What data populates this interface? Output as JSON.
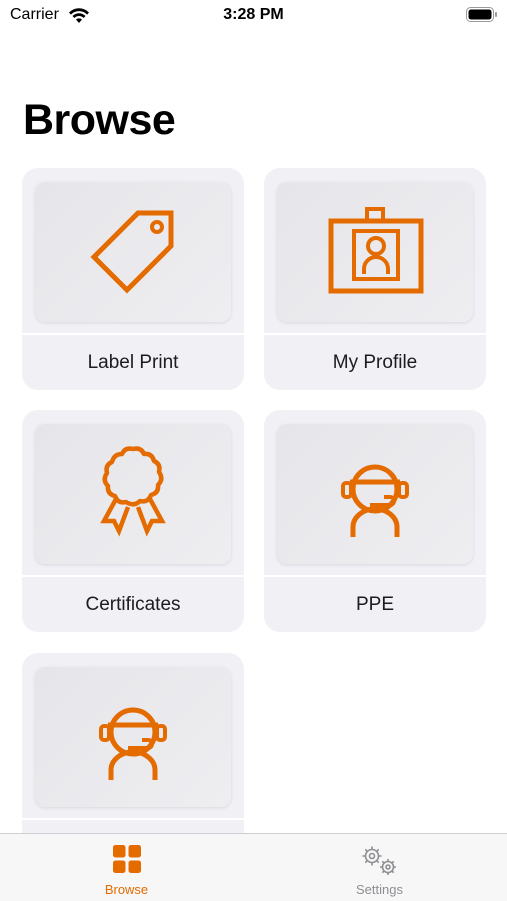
{
  "status_bar": {
    "carrier": "Carrier",
    "time": "3:28 PM"
  },
  "page": {
    "title": "Browse"
  },
  "accent_color": "#e46b00",
  "tiles": [
    {
      "label": "Label Print",
      "icon": "tag-icon"
    },
    {
      "label": "My Profile",
      "icon": "id-badge-icon"
    },
    {
      "label": "Certificates",
      "icon": "award-rosette-icon"
    },
    {
      "label": "PPE",
      "icon": "headset-person-icon"
    },
    {
      "label": "",
      "icon": "headset-person-icon"
    }
  ],
  "tab_bar": {
    "items": [
      {
        "label": "Browse",
        "icon": "grid-icon",
        "active": true
      },
      {
        "label": "Settings",
        "icon": "gears-icon",
        "active": false
      }
    ]
  }
}
